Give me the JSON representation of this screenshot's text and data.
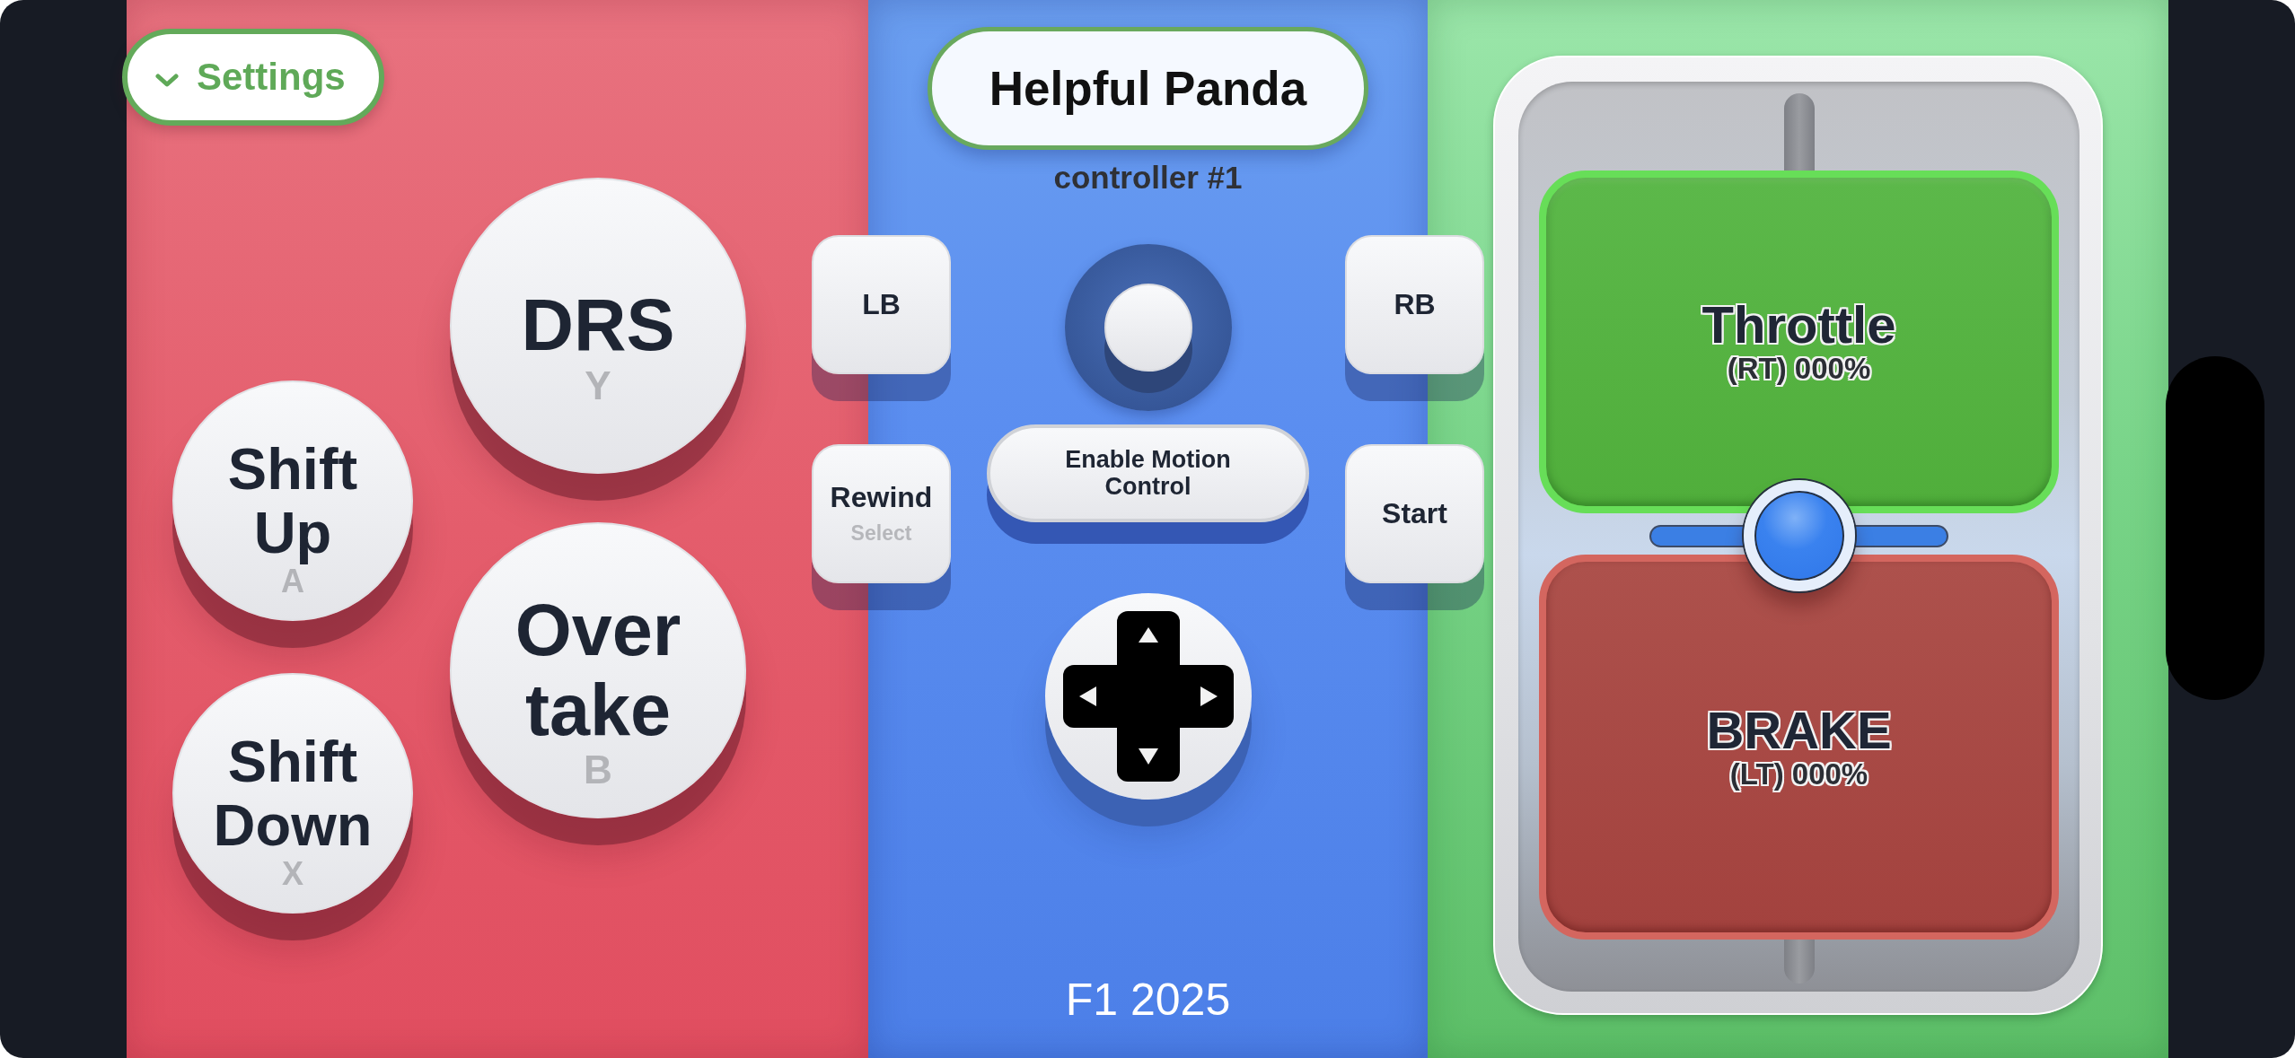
{
  "settings_button": {
    "label": "Settings"
  },
  "face_buttons": [
    {
      "label": "DRS",
      "key": "Y",
      "kind": "large"
    },
    {
      "label": "Shift Up",
      "key": "A",
      "kind": "small"
    },
    {
      "label": "Over take",
      "key": "B",
      "kind": "large"
    },
    {
      "label": "Shift Down",
      "key": "X",
      "kind": "small"
    }
  ],
  "profile": {
    "name": "Helpful Panda",
    "subtitle": "controller #1"
  },
  "side_buttons": {
    "left": [
      {
        "label": "LB"
      },
      {
        "label": "Rewind",
        "hint": "Select"
      }
    ],
    "right": [
      {
        "label": "RB"
      },
      {
        "label": "Start"
      }
    ]
  },
  "motion_button": {
    "label": "Enable Motion Control"
  },
  "footer": "F1 2025",
  "triggers": [
    {
      "label": "Throttle",
      "reading": "(RT) 000%",
      "kind": "throttle"
    },
    {
      "label": "BRAKE",
      "reading": "(LT) 000%",
      "kind": "brake"
    }
  ],
  "trigger_slider": {
    "level": 0.5
  }
}
